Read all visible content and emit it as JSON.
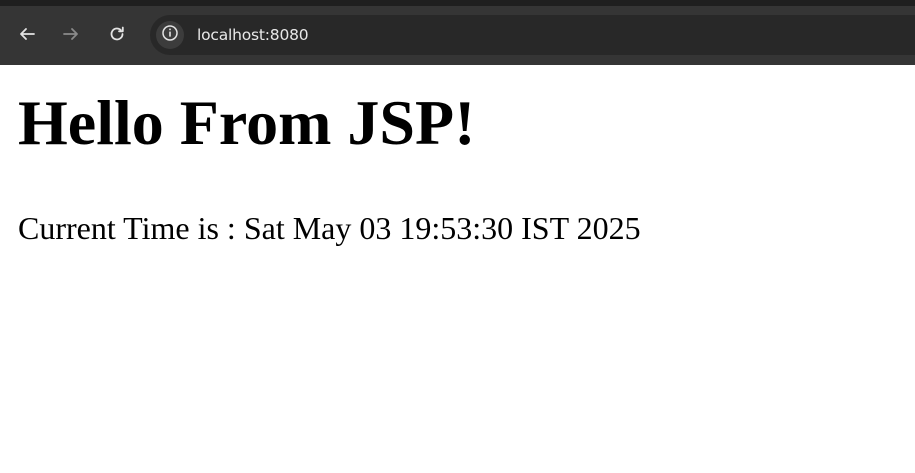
{
  "browser": {
    "url": "localhost:8080",
    "icons": {
      "back": "arrow-left-icon",
      "forward": "arrow-right-icon",
      "reload": "reload-icon",
      "site_info": "info-circle-icon"
    },
    "colors": {
      "toolbar": "#353535",
      "omnibox": "#282828",
      "url_text": "#e8e8e8"
    }
  },
  "page": {
    "heading": "Hello From JSP!",
    "time_label": "Current Time is : ",
    "time_value": "Sat May 03 19:53:30 IST 2025"
  }
}
